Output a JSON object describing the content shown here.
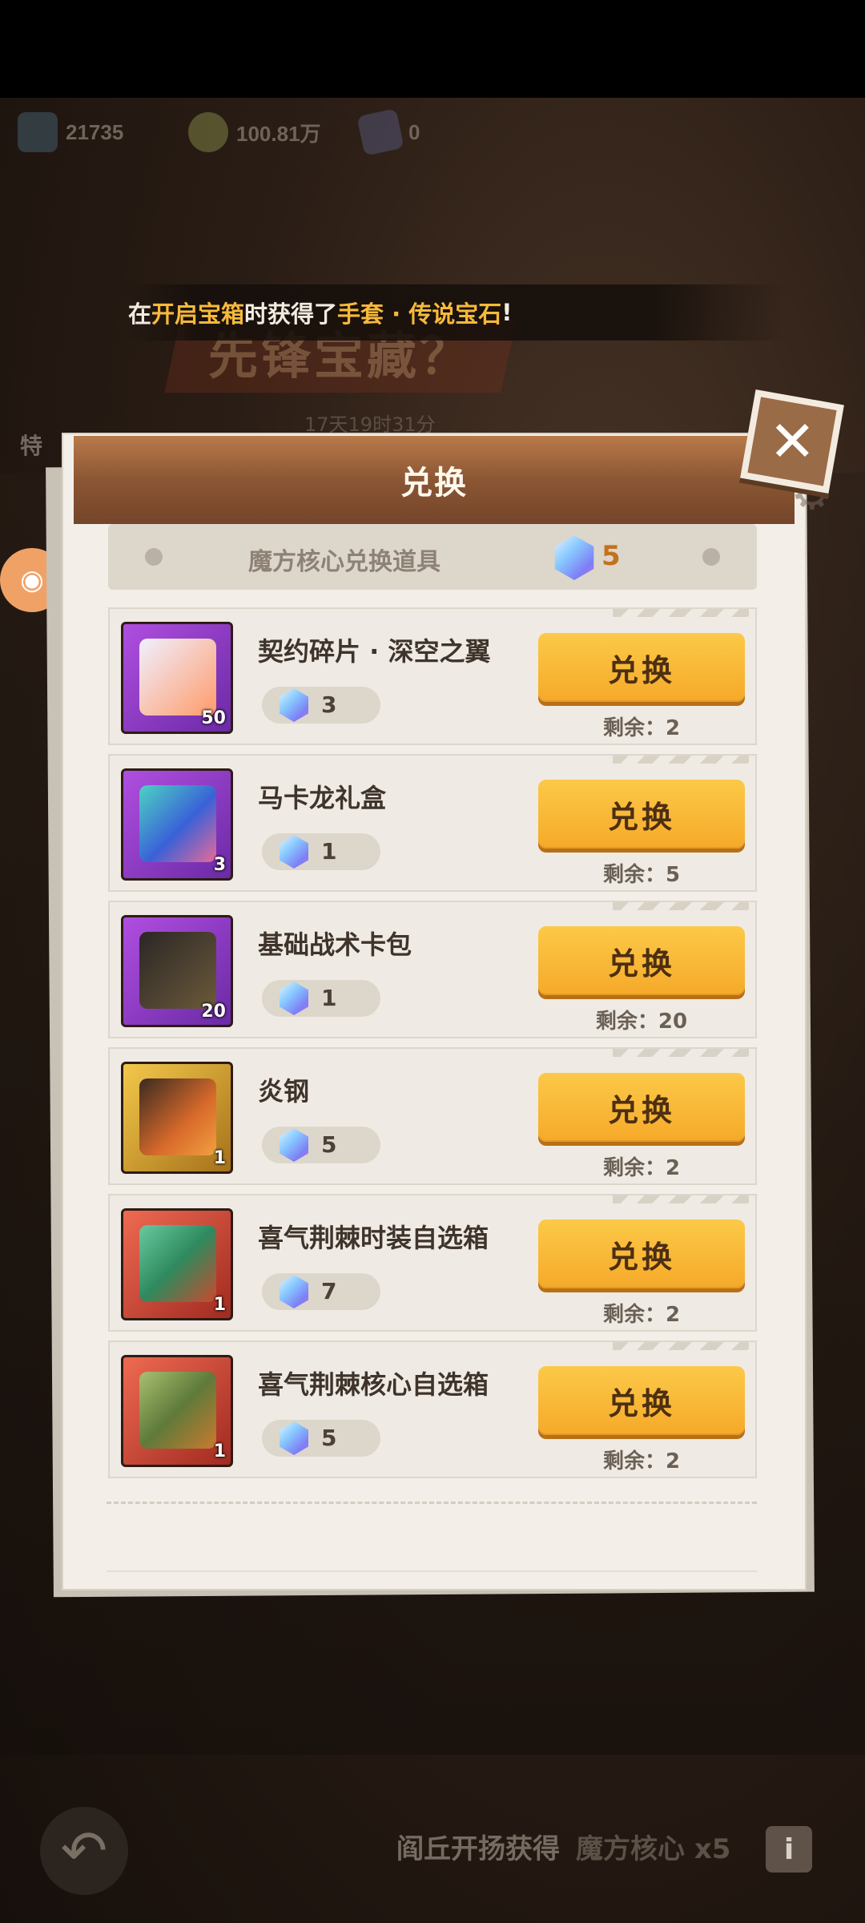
{
  "currencies": [
    {
      "icon": "gem-card-icon",
      "value": "21735"
    },
    {
      "icon": "gold-coin-icon",
      "value": "100.81万"
    },
    {
      "icon": "hero-card-icon",
      "value": "0"
    }
  ],
  "broadcast": {
    "prefix": "在",
    "highlight1": "开启宝箱",
    "middle": "时获得了",
    "highlight2": "手套 · 传说宝石",
    "suffix": "!"
  },
  "background": {
    "title": "先锋宝藏？",
    "timer": "17天19时31分",
    "side_label": "特"
  },
  "dialog": {
    "title": "兑换",
    "summary_label": "魔方核心兑换道具",
    "summary_count": "5",
    "button_label": "兑换",
    "remain_prefix": "剩余：",
    "items": [
      {
        "name": "契约碎片 · 深空之翼",
        "qty": "50",
        "cost": "3",
        "remain": "2",
        "frame": "purple"
      },
      {
        "name": "马卡龙礼盒",
        "qty": "3",
        "cost": "1",
        "remain": "5",
        "frame": "purple"
      },
      {
        "name": "基础战术卡包",
        "qty": "20",
        "cost": "1",
        "remain": "20",
        "frame": "purple"
      },
      {
        "name": "炎钢",
        "qty": "1",
        "cost": "5",
        "remain": "2",
        "frame": "gold"
      },
      {
        "name": "喜气荆棘时装自选箱",
        "qty": "1",
        "cost": "7",
        "remain": "2",
        "frame": "red"
      },
      {
        "name": "喜气荆棘核心自选箱",
        "qty": "1",
        "cost": "5",
        "remain": "2",
        "frame": "red"
      }
    ]
  },
  "footer": {
    "source_text": "阎丘开扬获得",
    "source_item": "魔方核心 x5",
    "info_icon": "info-icon",
    "back_icon": "back-arrow-icon"
  },
  "colors": {
    "accent": "#f6a929",
    "header_brown": "#8b5633",
    "highlight_text": "#f7b93a"
  }
}
